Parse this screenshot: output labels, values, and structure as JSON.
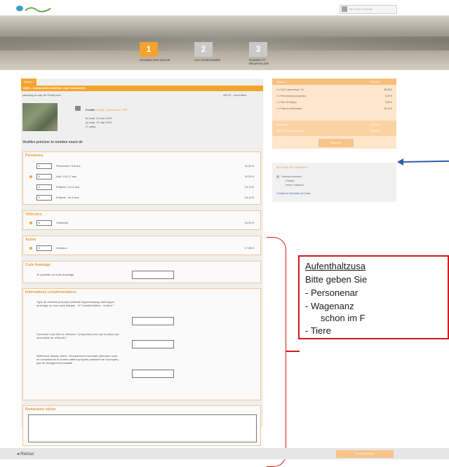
{
  "header": {
    "logo_text": "",
    "login_label": "Mon compte / Connexion"
  },
  "steps": [
    {
      "number": "1",
      "label": "INFORMATIONS SÉJOUR",
      "active": true
    },
    {
      "number": "2",
      "label": "VOS COORDONNÉES",
      "active": false
    },
    {
      "number": "3",
      "label": "PAIEMENT ET RÉCAPITULATIF",
      "active": false
    }
  ],
  "booking": {
    "stay_tag": "Séjour 1",
    "product_bar": "EMPL. CARAVANE/CAMPING-CAR STANDARD",
    "camping_name": "camping du cap de l'Homy aux",
    "camping_place": "40170 - Lit-et-Mixe",
    "package_label": "Forfait:",
    "package_link": "Forfait 2 personnes 1 PR",
    "date_from": "du sam. 04 mai 2019",
    "date_to": "au sam. 11 mai 2019",
    "nights": "(7 nuits)",
    "precise_text": "Veuillez préciser le nombre exact de"
  },
  "sections": {
    "persons": {
      "title": "Personnes",
      "rows": [
        {
          "qty": "1",
          "label": "Personnes +18 ans",
          "price": "31,50 €"
        },
        {
          "qty": "0",
          "label": "Ado 13 à 17 ans",
          "price": "31,50 €"
        },
        {
          "qty": "0",
          "label": "Enfants 7 à 12 ans",
          "price": "16,10 €"
        },
        {
          "qty": "0",
          "label": "Enfants - de 6 ans",
          "price": "16,10 €"
        }
      ]
    },
    "vehicles": {
      "title": "Véhicules",
      "rows": [
        {
          "qty": "0",
          "label": "Voiture(s)",
          "price": "15,00 €"
        }
      ]
    },
    "animals": {
      "title": "Autres",
      "rows": [
        {
          "qty": "0",
          "label": "Animaux",
          "price": "17,85 €"
        }
      ]
    },
    "code": {
      "title": "Code Avantage",
      "label": "Je possède un code avantage"
    },
    "info": {
      "title": "Informations complémentaires",
      "field1": "Type de véhicule principal (véhicule léger/camping-car/fourgon aménagé ou van/ vani) marque - N° immatriculation - couleur *",
      "field2": "Comment vous êtes le véhicule ? (Important pour que la place soit accessible au véhicule) *",
      "field3": "Référence dossier client - Emplacement souhaité (Attention nous ne connaissons le numéro attitré qu'après paiement de l'acompte) - pas de changement possible"
    },
    "remarks": {
      "title": "Remarques séjour"
    }
  },
  "summary": {
    "head_left": "Séjour 1",
    "head_right": "90,00 €",
    "lines": [
      {
        "label": "1 x Forf 2 pers+empl +1V",
        "value": "38,28 €"
      },
      {
        "label": "2 x Personne(s) complet(s)",
        "value": "0,00 €"
      },
      {
        "label": "1 x Taxe de Séjour",
        "value": "3,60 €"
      },
      {
        "label": "1 x Frais de réservation",
        "value": "30,00 €"
      }
    ],
    "total_label": "Acompte",
    "total_value": "10,00 €",
    "total2_label": "TOTAL (Tout compris)",
    "total2_value": "90,00 €",
    "button": "Réserver",
    "pay_title": "MOYENS DE PAIEMENT",
    "pay_opt1": "Paiement sécurisé",
    "pay_opt2": "- Chèque",
    "pay_opt3": "- Vente à distance",
    "pay_link": "Conditions Générales de Vente"
  },
  "note": {
    "line1": "Aufenthaltzusa",
    "line2": "Bitte geben Sie",
    "line3": "-    Personenar",
    "line4": "-     Wagenanz",
    "line5": "schon im  F",
    "line6": "- Tiere"
  },
  "footer": {
    "back": "Retour",
    "next": "Vos coordonnées"
  },
  "colors": {
    "accent": "#f4a32e",
    "accent_light": "#f8c48a",
    "annotation_red": "#d21a1a",
    "arrow_blue": "#2e5caa"
  }
}
